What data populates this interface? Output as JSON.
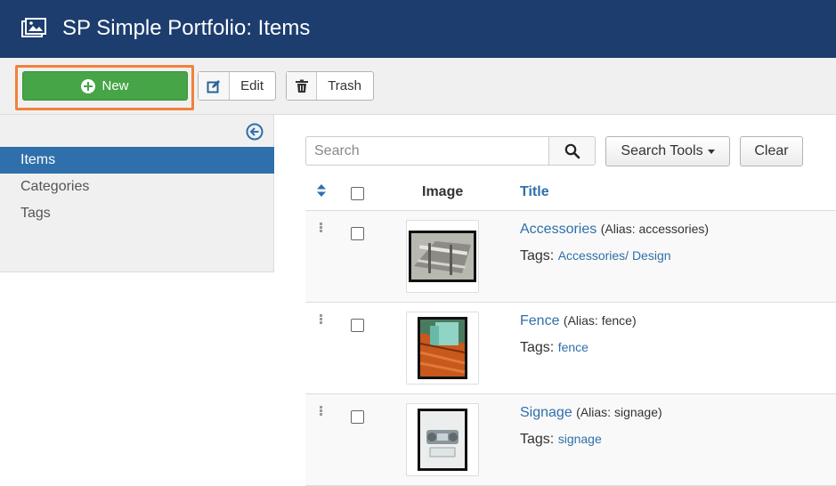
{
  "header": {
    "title": "SP Simple Portfolio: Items",
    "icon": "image-icon"
  },
  "toolbar": {
    "new_label": "New",
    "edit_label": "Edit",
    "trash_label": "Trash",
    "highlight_color": "#f0823a"
  },
  "sidebar": {
    "items": [
      {
        "label": "Items",
        "active": true
      },
      {
        "label": "Categories",
        "active": false
      },
      {
        "label": "Tags",
        "active": false
      }
    ]
  },
  "filters": {
    "search_placeholder": "Search",
    "search_tools_label": "Search Tools",
    "clear_label": "Clear"
  },
  "table": {
    "columns": {
      "image": "Image",
      "title": "Title"
    },
    "tags_prefix": "Tags:",
    "rows": [
      {
        "title": "Accessories",
        "alias": "(Alias: accessories)",
        "tags": "Accessories/ Design"
      },
      {
        "title": "Fence",
        "alias": "(Alias: fence)",
        "tags": "fence"
      },
      {
        "title": "Signage",
        "alias": "(Alias: signage)",
        "tags": "signage"
      }
    ]
  },
  "colors": {
    "header_bg": "#1c3d6e",
    "new_button": "#46a546",
    "active_sidebar": "#2f6fab",
    "link": "#2f6fab"
  }
}
